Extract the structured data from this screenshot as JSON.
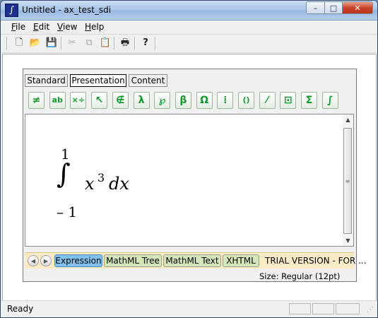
{
  "window": {
    "title": "Untitled - ax_test_sdi",
    "app_icon": "∫"
  },
  "title_buttons": {
    "minimize": "–",
    "maximize": "□",
    "close": "✕"
  },
  "menu": {
    "items": [
      "File",
      "Edit",
      "View",
      "Help"
    ]
  },
  "toolbar": {
    "buttons": [
      {
        "name": "new-icon",
        "glyph": "🗋",
        "enabled": true
      },
      {
        "name": "open-icon",
        "glyph": "📂",
        "enabled": true
      },
      {
        "name": "save-icon",
        "glyph": "💾",
        "enabled": true
      },
      {
        "name": "cut-icon",
        "glyph": "✂",
        "enabled": false
      },
      {
        "name": "copy-icon",
        "glyph": "⧉",
        "enabled": false
      },
      {
        "name": "paste-icon",
        "glyph": "📋",
        "enabled": false
      },
      {
        "name": "print-icon",
        "glyph": "🖶",
        "enabled": true
      },
      {
        "name": "help-icon",
        "glyph": "?",
        "enabled": true
      }
    ]
  },
  "editor": {
    "tabs": [
      "Standard",
      "Presentation",
      "Content"
    ],
    "active_tab": "Presentation",
    "symbol_buttons": [
      {
        "name": "not-equal-palette-icon",
        "glyph": "≠"
      },
      {
        "name": "text-style-palette-icon",
        "glyph": "ab"
      },
      {
        "name": "operators-palette-icon",
        "glyph": "×÷"
      },
      {
        "name": "arrows-palette-icon",
        "glyph": "↖"
      },
      {
        "name": "set-palette-icon",
        "glyph": "∉"
      },
      {
        "name": "lambda-palette-icon",
        "glyph": "λ"
      },
      {
        "name": "script-letters-palette-icon",
        "glyph": "℘"
      },
      {
        "name": "greek-palette-icon",
        "glyph": "β"
      },
      {
        "name": "omega-palette-icon",
        "glyph": "Ω"
      },
      {
        "name": "matrix-palette-icon",
        "glyph": "⁞"
      },
      {
        "name": "fences-palette-icon",
        "glyph": "()"
      },
      {
        "name": "fraction-palette-icon",
        "glyph": "⁄"
      },
      {
        "name": "script-palette-icon",
        "glyph": "⊡"
      },
      {
        "name": "sum-palette-icon",
        "glyph": "Σ"
      },
      {
        "name": "integral-palette-icon",
        "glyph": "∫"
      }
    ],
    "expression": {
      "integral": "∫",
      "upper_limit": "1",
      "lower_limit": "– 1",
      "base": "x",
      "exponent": "3",
      "differential": "dx"
    },
    "bottom_tabs": [
      "Expression",
      "MathML Tree",
      "MathML Text",
      "XHTML"
    ],
    "active_bottom_tab": "Expression",
    "trial_notice": "TRIAL VERSION - FOR ...",
    "size_label": "Size: Regular (12pt)"
  },
  "status": {
    "text": "Ready"
  },
  "colors": {
    "palette_glyph": "#119a2b",
    "active_bottom_tab": "#7fc1ef",
    "bottom_tab_bar": "#fbecc5"
  }
}
